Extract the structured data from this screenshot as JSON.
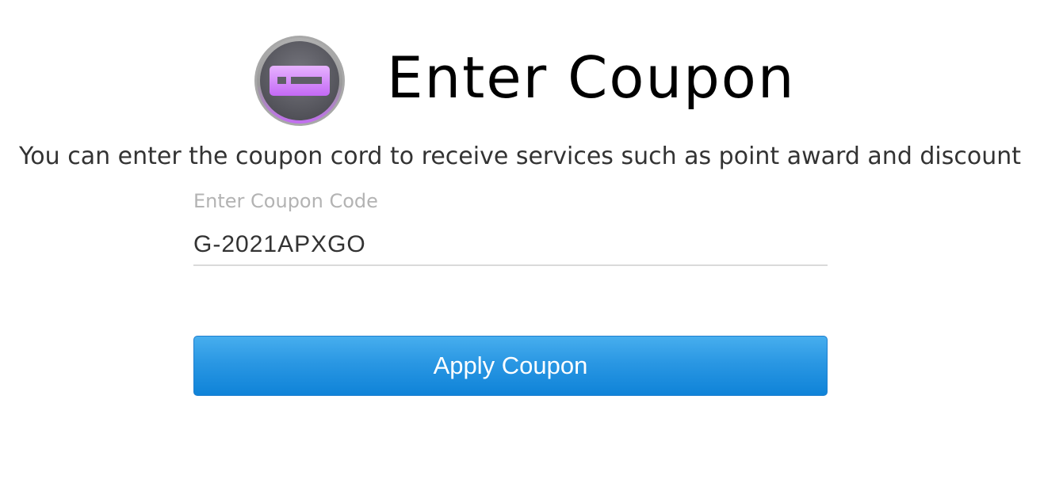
{
  "header": {
    "title": "Enter Coupon",
    "logo_icon": "coupon-ticket-icon"
  },
  "description": "You can enter the coupon cord to receive services such as point award and discount",
  "coupon_field": {
    "label": "Enter Coupon Code",
    "value": "G-2021APXGO"
  },
  "apply_button": {
    "label": "Apply Coupon"
  },
  "colors": {
    "accent": "#1a8fe0",
    "logo_ring": "#c36ef2",
    "logo_fill": "#5e5e66"
  }
}
